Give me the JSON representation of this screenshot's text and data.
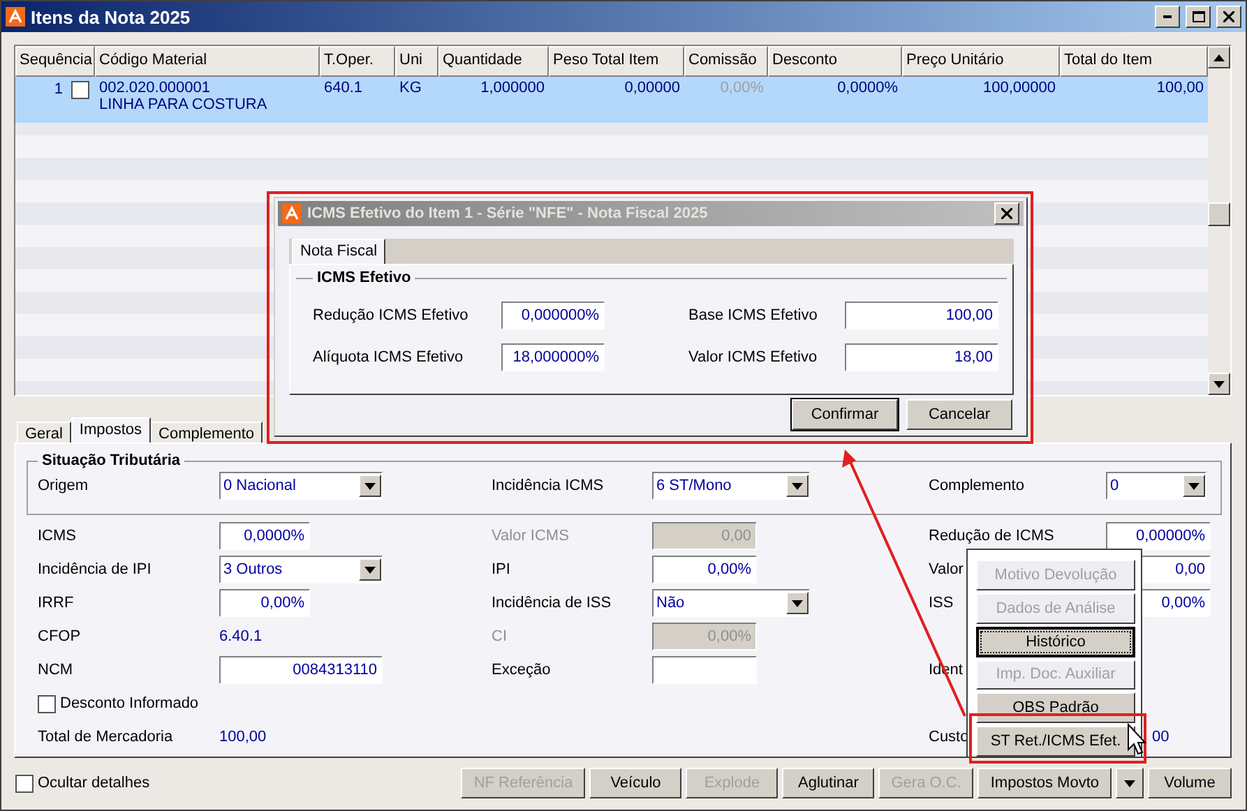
{
  "window": {
    "title": "Itens da Nota 2025"
  },
  "grid": {
    "columns": [
      "Sequência",
      "Código Material",
      "T.Oper.",
      "Uni",
      "Quantidade",
      "Peso Total Item",
      "Comissão",
      "Desconto",
      "Preço Unitário",
      "Total do Item"
    ],
    "rows": [
      {
        "selected": true,
        "checked": false,
        "cells": [
          {
            "text": "1"
          },
          {
            "text": "002.020.000001",
            "detail": "LINHA PARA COSTURA"
          },
          {
            "text": "640.1"
          },
          {
            "text": "KG"
          },
          {
            "text": "1,000000"
          },
          {
            "text": "0,00000"
          },
          {
            "text": "0,00%",
            "disabled": true
          },
          {
            "text": "0,0000%"
          },
          {
            "text": "100,00000"
          },
          {
            "text": "100,00"
          }
        ]
      }
    ]
  },
  "tabs": [
    {
      "label": "Geral",
      "selected": false
    },
    {
      "label": "Impostos",
      "selected": true
    },
    {
      "label": "Complemento",
      "selected": false
    }
  ],
  "situacao": {
    "title": "Situação Tributária",
    "fields": [
      {
        "label": "Origem",
        "kind": "select",
        "value": "0 Nacional"
      },
      {
        "label": "Incidência ICMS",
        "kind": "select",
        "value": "6 ST/Mono"
      },
      {
        "label": "Complemento",
        "kind": "select",
        "value": "0"
      }
    ]
  },
  "form_rows": [
    [
      {
        "label": "ICMS",
        "kind": "input",
        "value": "0,0000%"
      },
      {
        "label": "Valor ICMS",
        "kind": "input",
        "value": "0,00",
        "disabled": true
      },
      {
        "label": "Redução de ICMS",
        "kind": "input",
        "value": "0,00000%"
      }
    ],
    [
      {
        "label": "Incidência de IPI",
        "kind": "select",
        "value": "3 Outros"
      },
      {
        "label": "IPI",
        "kind": "input",
        "value": "0,00%"
      },
      {
        "label": "Valor",
        "kind": "input",
        "value": "0,00"
      }
    ],
    [
      {
        "label": "IRRF",
        "kind": "input",
        "value": "0,00%"
      },
      {
        "label": "Incidência de ISS",
        "kind": "select",
        "value": "Não"
      },
      {
        "label": "ISS",
        "kind": "input",
        "value": "0,00%"
      }
    ],
    [
      {
        "label": "CFOP",
        "kind": "text",
        "value": "6.40.1"
      },
      {
        "label": "CI",
        "kind": "input",
        "value": "0,00%",
        "disabled": true
      }
    ],
    [
      {
        "label": "NCM",
        "kind": "input",
        "value": "0084313110"
      },
      {
        "label": "Exceção",
        "kind": "input"
      },
      {
        "label": "Ident",
        "kind": "none"
      }
    ]
  ],
  "desconto": {
    "label": "Desconto Informado",
    "checked": false
  },
  "totals": [
    {
      "label": "Total de Mercadoria",
      "value": "100,00"
    },
    {
      "label": "Custo",
      "value": "00"
    }
  ],
  "footer": {
    "checkbox": {
      "label": "Ocultar detalhes",
      "checked": false
    },
    "buttons": [
      {
        "label": "NF Referência",
        "kind": "button",
        "disabled": true
      },
      {
        "label": "Veículo",
        "kind": "button",
        "disabled": false
      },
      {
        "label": "Explode",
        "kind": "button",
        "disabled": true
      },
      {
        "label": "Aglutinar",
        "kind": "button",
        "disabled": false
      },
      {
        "label": "Gera O.C.",
        "kind": "button",
        "disabled": true
      },
      {
        "label": "Impostos Movto",
        "kind": "button",
        "disabled": false
      },
      {
        "kind": "dropdown",
        "disabled": false
      },
      {
        "label": "Volume",
        "kind": "button",
        "disabled": false
      }
    ]
  },
  "popup_menu": {
    "items": [
      {
        "label": "Motivo Devolução",
        "disabled": true,
        "focused": false
      },
      {
        "label": "Dados de Análise",
        "disabled": true,
        "focused": false
      },
      {
        "label": "Histórico",
        "disabled": false,
        "focused": true
      },
      {
        "label": "Imp. Doc. Auxiliar",
        "disabled": true,
        "focused": false
      },
      {
        "label": "OBS Padrão",
        "disabled": false,
        "focused": false
      },
      {
        "label": "ST Ret./ICMS Efet.",
        "disabled": false,
        "focused": false
      }
    ]
  },
  "dialog": {
    "title": "ICMS Efetivo do Item 1 - Série \"NFE\" - Nota Fiscal 2025",
    "tabs": [
      {
        "label": "Nota Fiscal",
        "selected": true
      }
    ],
    "group": "ICMS Efetivo",
    "fields": [
      {
        "label": "Redução ICMS Efetivo",
        "value": "0,000000%"
      },
      {
        "label": "Base ICMS Efetivo",
        "value": "100,00"
      },
      {
        "label": "Alíquota ICMS Efetivo",
        "value": "18,000000%"
      },
      {
        "label": "Valor ICMS Efetivo",
        "value": "18,00"
      }
    ],
    "buttons": [
      {
        "label": "Confirmar",
        "default": true
      },
      {
        "label": "Cancelar",
        "default": false
      }
    ]
  }
}
